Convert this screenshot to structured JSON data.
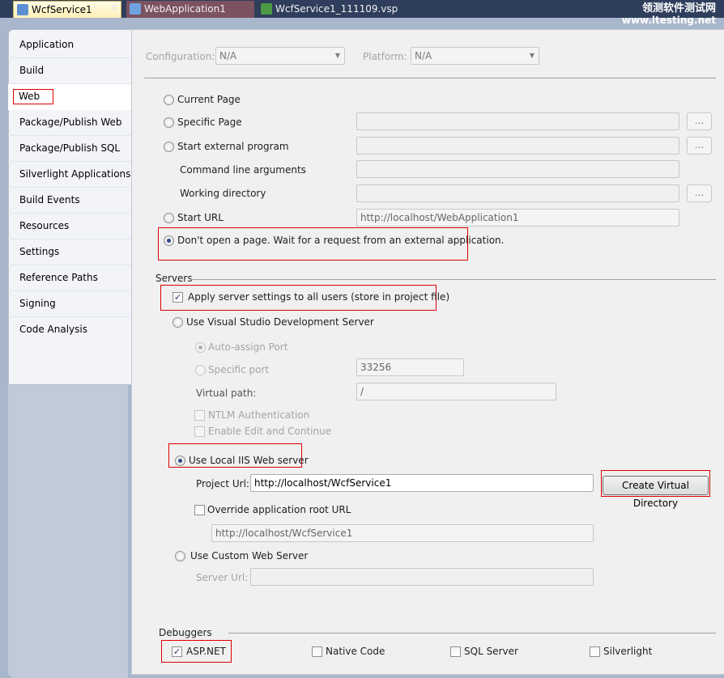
{
  "tabs": [
    {
      "label": "WcfService1",
      "icon": "web-project-icon",
      "active": true
    },
    {
      "label": "WebApplication1",
      "icon": "web-project-icon",
      "active": false
    },
    {
      "label": "WcfService1_111109.vsp",
      "icon": "performance-session-icon",
      "active": false
    }
  ],
  "tab_close_glyph": "✕",
  "watermark": {
    "line1": "领测软件测试网",
    "line2": "www.ltesting.net"
  },
  "nav": {
    "items": [
      "Application",
      "Build",
      "Web",
      "Package/Publish Web",
      "Package/Publish SQL",
      "Silverlight Applications",
      "Build Events",
      "Resources",
      "Settings",
      "Reference Paths",
      "Signing",
      "Code Analysis"
    ],
    "selected": "Web"
  },
  "config": {
    "configuration_label": "Configuration:",
    "configuration_value": "N/A",
    "platform_label": "Platform:",
    "platform_value": "N/A"
  },
  "start_action": {
    "current_page": "Current Page",
    "specific_page": "Specific Page",
    "start_external_program": "Start external program",
    "command_line_arguments": "Command line arguments",
    "working_directory": "Working directory",
    "start_url": "Start URL",
    "start_url_value": "http://localhost/WebApplication1",
    "dont_open": "Don't open a page.  Wait for a request from an external application.",
    "ellipsis": "...",
    "selected": "dont_open"
  },
  "servers": {
    "section_label": "Servers",
    "apply_all_users": "Apply server settings to all users (store in project file)",
    "apply_all_users_checked": true,
    "use_vs_dev_server": "Use Visual Studio Development Server",
    "auto_assign_port": "Auto-assign Port",
    "specific_port": "Specific port",
    "specific_port_value": "33256",
    "virtual_path_label": "Virtual path:",
    "virtual_path_value": "/",
    "ntlm_auth": "NTLM Authentication",
    "edit_and_continue": "Enable Edit and Continue",
    "use_local_iis": "Use Local IIS Web server",
    "project_url_label": "Project Url:",
    "project_url_value": "http://localhost/WcfService1",
    "create_virtual_directory": "Create Virtual Directory",
    "override_root_url": "Override application root URL",
    "override_root_url_value": "http://localhost/WcfService1",
    "use_custom_server": "Use Custom Web Server",
    "server_url_label": "Server Url:",
    "selected": "use_local_iis"
  },
  "debuggers": {
    "section_label": "Debuggers",
    "items": [
      {
        "label": "ASP.NET",
        "checked": true
      },
      {
        "label": "Native Code",
        "checked": false
      },
      {
        "label": "SQL Server",
        "checked": false
      },
      {
        "label": "Silverlight",
        "checked": false
      }
    ]
  },
  "check_glyph": "✓",
  "colors": {
    "highlight": "#e00000",
    "tab_strip": "#2e3e5c",
    "active_tab": "#fff0b8"
  }
}
